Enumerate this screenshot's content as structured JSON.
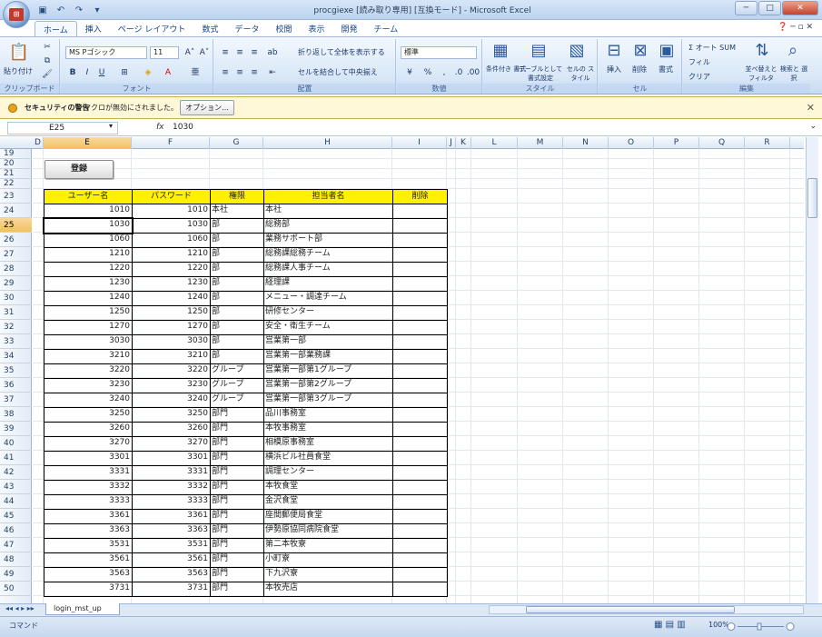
{
  "window": {
    "title": "procgiexe  [読み取り専用]  [互換モード] - Microsoft Excel",
    "controls": {
      "minimize": "─",
      "maximize": "□",
      "close": "✕"
    }
  },
  "ribbon": {
    "tabs": [
      "ホーム",
      "挿入",
      "ページ レイアウト",
      "数式",
      "データ",
      "校閲",
      "表示",
      "開発",
      "チーム"
    ],
    "active_tab": "ホーム",
    "clipboard": {
      "paste": "貼り付け",
      "label": "クリップボード"
    },
    "font": {
      "name": "MS Pゴシック",
      "size": "11",
      "label": "フォント"
    },
    "alignment": {
      "wrap": "折り返して全体を表示する",
      "merge": "セルを結合して中央揃え",
      "label": "配置"
    },
    "number": {
      "format": "標準",
      "label": "数値"
    },
    "style": {
      "conditional": "条件付き 書式",
      "as_table": "テーブルとして 書式設定",
      "cell_style": "セルの スタイル",
      "label": "スタイル"
    },
    "cells": {
      "insert": "挿入",
      "delete": "削除",
      "format": "書式",
      "label": "セル"
    },
    "editing": {
      "autosum": "Σ オート SUM",
      "fill": "フィル",
      "clear": "クリア",
      "sort": "並べ替えと フィルタ",
      "find": "検索と 選択",
      "label": "編集"
    }
  },
  "security": {
    "title": "セキュリティの警告",
    "message": "マクロが無効にされました。",
    "option_button": "オプション..."
  },
  "formula_bar": {
    "name_box": "E25",
    "fx": "fx",
    "value": "1030"
  },
  "columns": [
    "D",
    "E",
    "F",
    "G",
    "H",
    "I",
    "J",
    "K",
    "L",
    "M",
    "N",
    "O",
    "P",
    "Q",
    "R"
  ],
  "row_numbers": [
    "19",
    "20",
    "21",
    "22",
    "23",
    "24",
    "25",
    "26",
    "27",
    "28",
    "29",
    "30",
    "31",
    "32",
    "33",
    "34",
    "35",
    "36",
    "37",
    "38",
    "39",
    "40",
    "41",
    "42",
    "43",
    "44",
    "45",
    "46",
    "47",
    "48",
    "49",
    "50"
  ],
  "register_button": "登録",
  "table": {
    "headers": [
      "ユーザー名",
      "パスワード",
      "権限",
      "担当者名",
      "削除"
    ],
    "rows": [
      [
        "1010",
        "1010",
        "本社",
        "本社"
      ],
      [
        "1030",
        "1030",
        "部",
        "総務部"
      ],
      [
        "1060",
        "1060",
        "部",
        "業務サポート部"
      ],
      [
        "1210",
        "1210",
        "部",
        "総務課総務チーム"
      ],
      [
        "1220",
        "1220",
        "部",
        "総務課人事チーム"
      ],
      [
        "1230",
        "1230",
        "部",
        "経理課"
      ],
      [
        "1240",
        "1240",
        "部",
        "メニュー・調達チーム"
      ],
      [
        "1250",
        "1250",
        "部",
        "研修センター"
      ],
      [
        "1270",
        "1270",
        "部",
        "安全・衛生チーム"
      ],
      [
        "3030",
        "3030",
        "部",
        "営業第一部"
      ],
      [
        "3210",
        "3210",
        "部",
        "営業第一部業務課"
      ],
      [
        "3220",
        "3220",
        "グループ",
        "営業第一部第1グループ"
      ],
      [
        "3230",
        "3230",
        "グループ",
        "営業第一部第2グループ"
      ],
      [
        "3240",
        "3240",
        "グループ",
        "営業第一部第3グループ"
      ],
      [
        "3250",
        "3250",
        "部門",
        "品川事務室"
      ],
      [
        "3260",
        "3260",
        "部門",
        "本牧事務室"
      ],
      [
        "3270",
        "3270",
        "部門",
        "相模原事務室"
      ],
      [
        "3301",
        "3301",
        "部門",
        "横浜ビル社員食堂"
      ],
      [
        "3331",
        "3331",
        "部門",
        "調理センター"
      ],
      [
        "3332",
        "3332",
        "部門",
        "本牧食堂"
      ],
      [
        "3333",
        "3333",
        "部門",
        "金沢食堂"
      ],
      [
        "3361",
        "3361",
        "部門",
        "座間郵便局食堂"
      ],
      [
        "3363",
        "3363",
        "部門",
        "伊勢原協同病院食堂"
      ],
      [
        "3531",
        "3531",
        "部門",
        "第二本牧寮"
      ],
      [
        "3561",
        "3561",
        "部門",
        "小町寮"
      ],
      [
        "3563",
        "3563",
        "部門",
        "下九沢寮"
      ],
      [
        "3731",
        "3731",
        "部門",
        "本牧売店"
      ]
    ]
  },
  "sheet_tab": "login_mst_up",
  "status": {
    "mode": "コマンド",
    "zoom": "100%"
  }
}
